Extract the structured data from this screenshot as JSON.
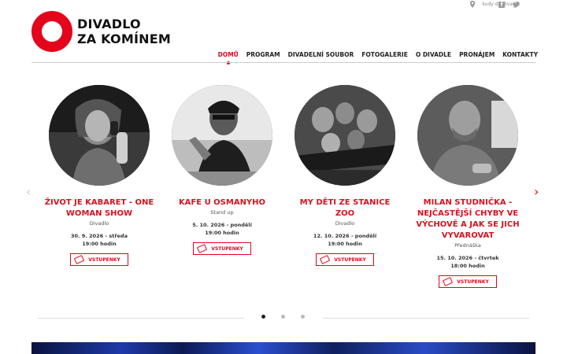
{
  "logo": {
    "line1": "DIVADLO",
    "line2": "ZA KOMÍNEM"
  },
  "topbar": {
    "location_link": "kudy do divadla"
  },
  "nav": {
    "items": [
      "DOMŮ",
      "PROGRAM",
      "DIVADELNÍ SOUBOR",
      "FOTOGALERIE",
      "O DIVADLE",
      "PRONÁJEM",
      "KONTAKTY"
    ],
    "active_index": 0
  },
  "carousel": {
    "prev_arrow": "‹",
    "next_arrow": "›",
    "cards": [
      {
        "title": "ŽIVOT JE KABARET - ONE WOMAN SHOW",
        "category": "Divadlo",
        "date": "30. 9. 2026 - středa",
        "time": "19:00 hodin",
        "ticket_label": "VSTUPENKY"
      },
      {
        "title": "KAFE U OSMANYHO",
        "category": "Stand up",
        "date": "5. 10. 2026 - pondělí",
        "time": "19:00 hodin",
        "ticket_label": "VSTUPENKY"
      },
      {
        "title": "MY DĚTI ZE STANICE ZOO",
        "category": "Divadlo",
        "date": "12. 10. 2026 - pondělí",
        "time": "19:00 hodin",
        "ticket_label": "VSTUPENKY"
      },
      {
        "title": "MILAN STUDNIČKA - NEJČASTĚJŠÍ CHYBY VE VÝCHOVĚ A JAK SE JICH VYVAROVAT",
        "category": "Přednáška",
        "date": "15. 10. 2026 - čtvrtek",
        "time": "18:00 hodin",
        "ticket_label": "VSTUPENKY"
      }
    ],
    "page_count": 3,
    "active_page": 0
  },
  "colors": {
    "brand_red": "#e3051b",
    "title_red": "#d7121f",
    "text": "#222222"
  }
}
